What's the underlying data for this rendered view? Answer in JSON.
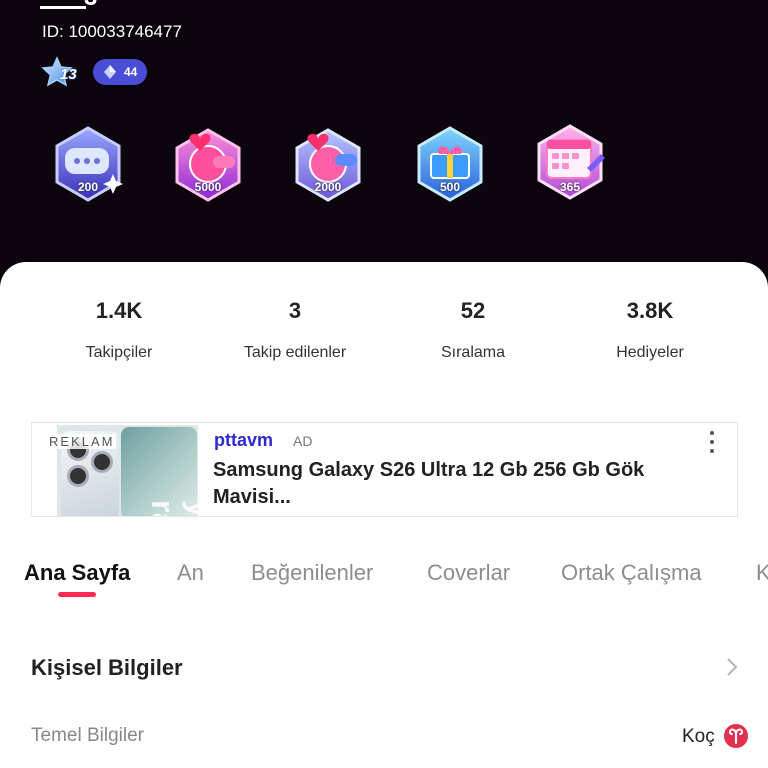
{
  "profile": {
    "username_partial": "3",
    "id_text": "ID: 100033746477",
    "level": "13",
    "gem_count": "44"
  },
  "badges": [
    {
      "icon": "chat-bubble-badge-icon",
      "label": "200"
    },
    {
      "icon": "hearts-hot-badge-icon",
      "label": "5000"
    },
    {
      "icon": "hearts-hot-badge-icon",
      "label": "2000"
    },
    {
      "icon": "gift-box-badge-icon",
      "label": "500"
    },
    {
      "icon": "calendar-badge-icon",
      "label": "365"
    }
  ],
  "stats": [
    {
      "value": "1.4K",
      "label": "Takipçiler"
    },
    {
      "value": "3",
      "label": "Takip edilenler"
    },
    {
      "value": "52",
      "label": "Sıralama"
    },
    {
      "value": "3.8K",
      "label": "Hediyeler"
    }
  ],
  "ad": {
    "reklam": "REKLAM",
    "brand": "pttavm",
    "tag": "AD",
    "title": "Samsung Galaxy S26 Ultra 12 Gb 256 Gb Gök Mavisi...",
    "image_text": "y ra"
  },
  "tabs": [
    "Ana Sayfa",
    "An",
    "Beğenilenler",
    "Coverlar",
    "Ortak Çalışma",
    "K"
  ],
  "info": {
    "section_title": "Kişisel Bilgiler",
    "row_label": "Temel Bilgiler",
    "row_value": "Koç",
    "zodiac_icon": "aries-icon"
  },
  "colors": {
    "accent": "#fe2c55",
    "header_bg": "#0d050d",
    "ad_brand": "#2b2bd2",
    "gem_pill": "#4a4ed6"
  }
}
